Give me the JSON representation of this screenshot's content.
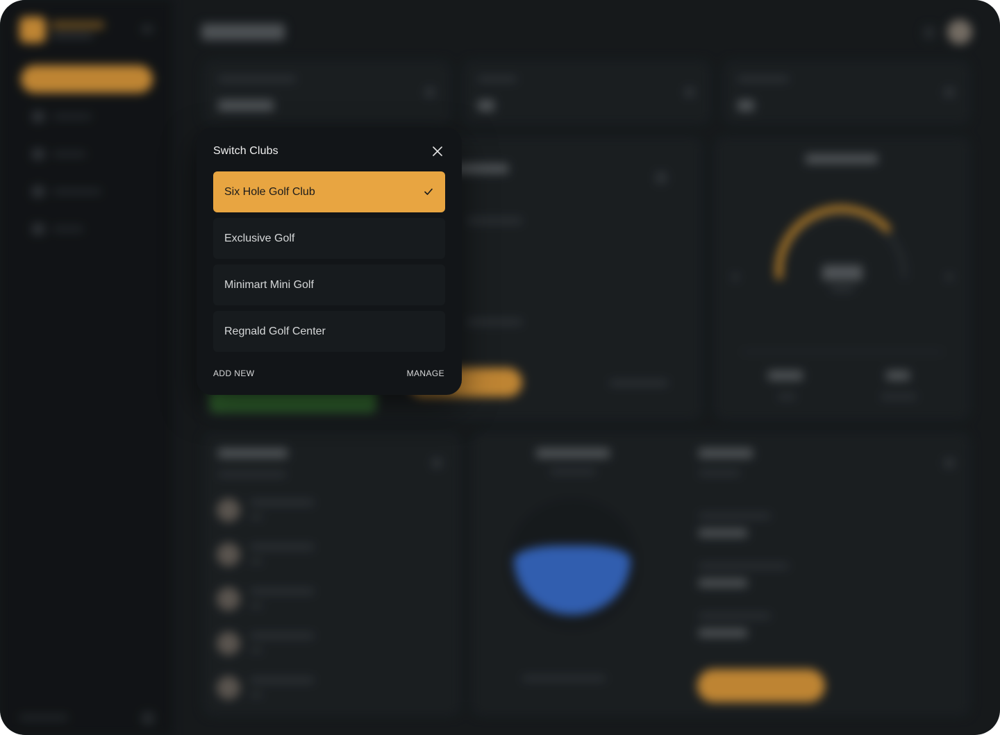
{
  "modal": {
    "title": "Switch Clubs",
    "close_icon": "close-icon",
    "clubs": [
      {
        "label": "Six Hole Golf Club",
        "selected": true
      },
      {
        "label": "Exclusive Golf",
        "selected": false
      },
      {
        "label": "Minimart Mini Golf",
        "selected": false
      },
      {
        "label": "Regnald Golf Center",
        "selected": false
      }
    ],
    "selected_icon": "check-icon",
    "footer": {
      "add_new": "ADD NEW",
      "manage": "MANAGE"
    }
  },
  "colors": {
    "accent": "#e8a541",
    "modal_bg": "#121518",
    "page_bg": "#1b1f22",
    "sidebar_bg": "#15181b"
  }
}
